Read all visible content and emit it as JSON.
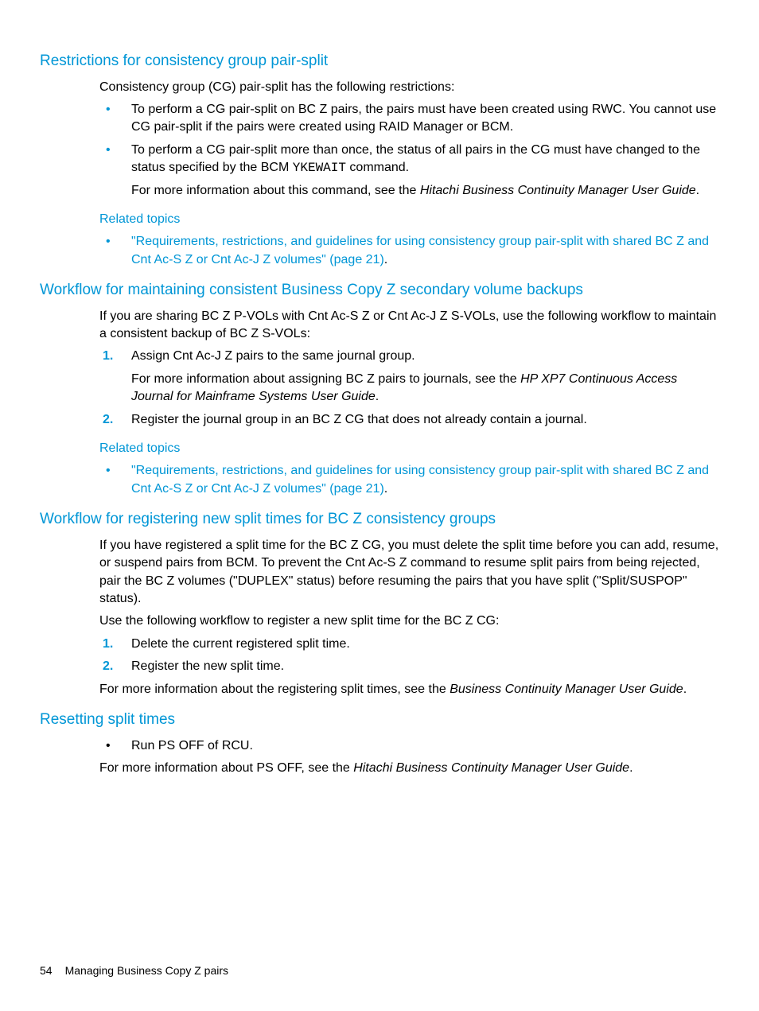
{
  "sections": {
    "restrictions": {
      "heading": "Restrictions for consistency group pair-split",
      "intro": "Consistency group (CG) pair-split has the following restrictions:",
      "bullet1": "To perform a CG pair-split on BC Z pairs, the pairs must have been created using RWC. You cannot use CG pair-split if the pairs were created using RAID Manager or BCM.",
      "bullet2_a": "To perform a CG pair-split more than once, the status of all pairs in the CG must have changed to the status specified by the BCM ",
      "bullet2_code": "YKEWAIT",
      "bullet2_b": " command.",
      "bullet2_more_a": "For more information about this command, see the ",
      "bullet2_more_i": "Hitachi Business Continuity Manager User Guide",
      "bullet2_more_b": ".",
      "related_label": "Related topics",
      "related_link": "\"Requirements, restrictions, and guidelines for using consistency group pair-split with shared BC Z and Cnt Ac-S Z or Cnt Ac-J Z volumes\" (page 21)",
      "related_tail": "."
    },
    "workflow_backup": {
      "heading": "Workflow for maintaining consistent Business Copy Z secondary volume backups",
      "intro": "If you are sharing BC Z P-VOLs with Cnt Ac-S Z or Cnt Ac-J Z S-VOLs, use the following workflow to maintain a consistent backup of BC Z S-VOLs:",
      "step1": "Assign Cnt Ac-J Z pairs to the same journal group.",
      "step1_more_a": "For more information about assigning BC Z pairs to journals, see the ",
      "step1_more_i": "HP XP7 Continuous Access Journal for Mainframe Systems User Guide",
      "step1_more_b": ".",
      "step2": "Register the journal group in an BC Z CG that does not already contain a journal.",
      "related_label": "Related topics",
      "related_link": "\"Requirements, restrictions, and guidelines for using consistency group pair-split with shared BC Z and Cnt Ac-S Z or Cnt Ac-J Z volumes\" (page 21)",
      "related_tail": "."
    },
    "workflow_split": {
      "heading": "Workflow for registering new split times for BC Z consistency groups",
      "p1": "If you have registered a split time for the BC Z CG, you must delete the split time before you can add, resume, or suspend pairs from BCM. To prevent the Cnt Ac-S Z command to resume split pairs from being rejected, pair the BC Z volumes (\"DUPLEX\" status) before resuming the pairs that you have split (\"Split/SUSPOP\" status).",
      "p2": "Use the following workflow to register a new split time for the BC Z CG:",
      "step1": "Delete the current registered split time.",
      "step2": "Register the new split time.",
      "more_a": "For more information about the registering split times, see the ",
      "more_i": "Business Continuity Manager User Guide",
      "more_b": "."
    },
    "resetting": {
      "heading": "Resetting split times",
      "bullet1": "Run PS OFF of RCU.",
      "more_a": "For more information about PS OFF, see the ",
      "more_i": "Hitachi Business Continuity Manager User Guide",
      "more_b": "."
    }
  },
  "footer": {
    "page": "54",
    "title": "Managing Business Copy Z pairs"
  }
}
